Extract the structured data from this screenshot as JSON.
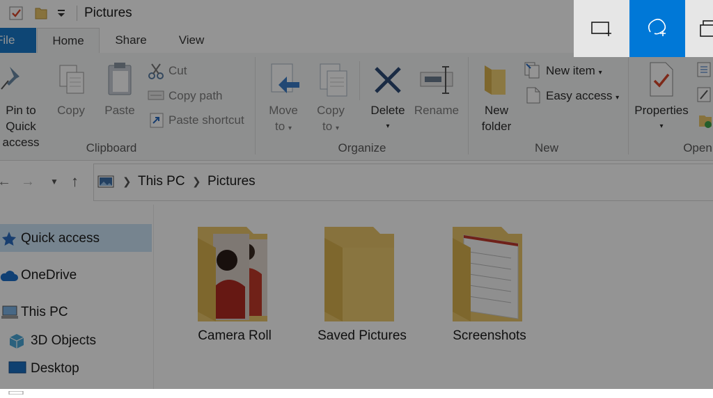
{
  "window": {
    "title": "Pictures"
  },
  "ribbon_tabs": {
    "file": "File",
    "home": "Home",
    "share": "Share",
    "view": "View"
  },
  "clipboard": {
    "pin_line1": "Pin to Quick",
    "pin_line2": "access",
    "copy": "Copy",
    "paste": "Paste",
    "cut": "Cut",
    "copy_path": "Copy path",
    "paste_shortcut": "Paste shortcut",
    "group": "Clipboard"
  },
  "organize": {
    "move_line1": "Move",
    "move_line2": "to",
    "copy_line1": "Copy",
    "copy_line2": "to",
    "delete": "Delete",
    "rename": "Rename",
    "group": "Organize"
  },
  "new": {
    "new_folder_line1": "New",
    "new_folder_line2": "folder",
    "new_item": "New item",
    "easy_access": "Easy access",
    "group": "New"
  },
  "open": {
    "properties": "Properties",
    "group": "Open"
  },
  "address": {
    "this_pc": "This PC",
    "pictures": "Pictures"
  },
  "nav": {
    "quick_access": "Quick access",
    "onedrive": "OneDrive",
    "this_pc": "This PC",
    "objects3d": "3D Objects",
    "desktop": "Desktop"
  },
  "folders": [
    "Camera Roll",
    "Saved Pictures",
    "Screenshots"
  ],
  "colors": {
    "accent": "#1979ca",
    "snip_active": "#0078d7",
    "folder": "#e8c46a",
    "selection": "#cce4f7"
  }
}
